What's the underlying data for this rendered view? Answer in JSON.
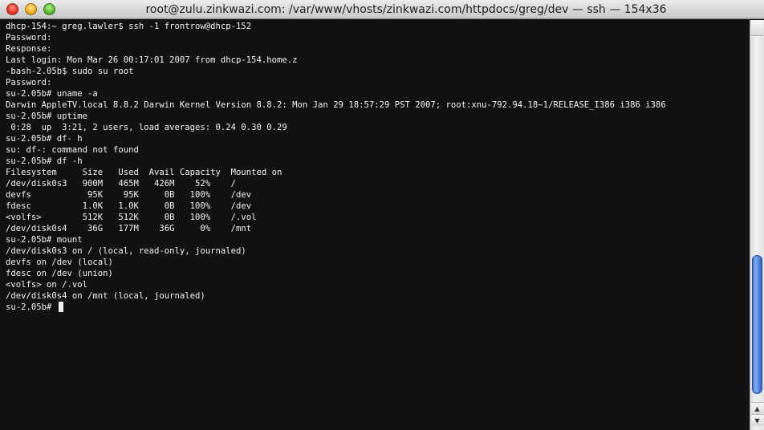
{
  "window": {
    "title": "root@zulu.zinkwazi.com: /var/www/vhosts/zinkwazi.com/httpdocs/greg/dev — ssh — 154x36",
    "buttons": {
      "close": "close-button",
      "minimize": "minimize-button",
      "zoom": "zoom-button"
    }
  },
  "terminal": {
    "lines": [
      "dhcp-154:~ greg.lawler$ ssh -1 frontrow@dhcp-152",
      "Password:",
      "Response:",
      "Last login: Mon Mar 26 00:17:01 2007 from dhcp-154.home.z",
      "-bash-2.05b$ sudo su root",
      "Password:",
      "su-2.05b# uname -a",
      "Darwin AppleTV.local 8.8.2 Darwin Kernel Version 8.8.2: Mon Jan 29 18:57:29 PST 2007; root:xnu-792.94.18~1/RELEASE_I386 i386 i386",
      "su-2.05b# uptime",
      " 0:28  up  3:21, 2 users, load averages: 0.24 0.30 0.29",
      "su-2.05b# df- h",
      "su: df-: command not found",
      "su-2.05b# df -h",
      "Filesystem     Size   Used  Avail Capacity  Mounted on",
      "/dev/disk0s3   900M   465M   426M    52%    /",
      "devfs           95K    95K     0B   100%    /dev",
      "fdesc          1.0K   1.0K     0B   100%    /dev",
      "<volfs>        512K   512K     0B   100%    /.vol",
      "/dev/disk0s4    36G   177M    36G     0%    /mnt",
      "su-2.05b# mount",
      "/dev/disk0s3 on / (local, read-only, journaled)",
      "devfs on /dev (local)",
      "fdesc on /dev (union)",
      "<volfs> on /.vol",
      "/dev/disk0s4 on /mnt (local, journaled)",
      "su-2.05b# "
    ],
    "colors": {
      "background": "#111111",
      "foreground": "#f2f2f2",
      "cursor": "#f2f2f2"
    }
  },
  "scrollbar": {
    "thumb_color": "#4a84e0",
    "up_arrow_icon": "scroll-up-arrow-icon",
    "down_arrow_icon": "scroll-down-arrow-icon"
  }
}
